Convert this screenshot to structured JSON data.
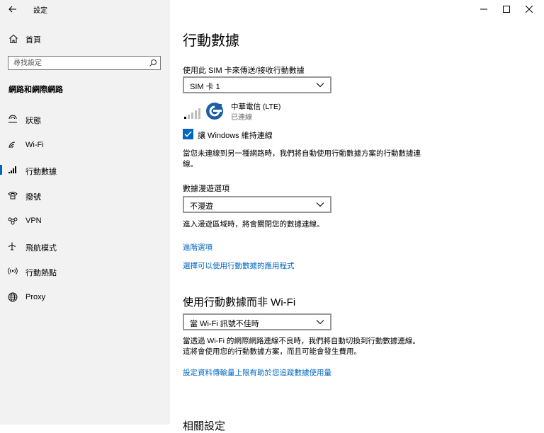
{
  "window": {
    "app_title": "設定",
    "minimize_icon": "minimize-icon",
    "maximize_icon": "maximize-icon",
    "close_icon": "close-icon"
  },
  "sidebar": {
    "home_label": "首頁",
    "search_placeholder": "尋找設定",
    "section_title": "網路和網際網路",
    "items": [
      {
        "label": "狀態",
        "icon": "status-icon"
      },
      {
        "label": "Wi-Fi",
        "icon": "wifi-icon"
      },
      {
        "label": "行動數據",
        "icon": "cellular-icon",
        "selected": true
      },
      {
        "label": "撥號",
        "icon": "dialup-icon"
      },
      {
        "label": "VPN",
        "icon": "vpn-icon"
      },
      {
        "label": "飛航模式",
        "icon": "airplane-icon"
      },
      {
        "label": "行動熱點",
        "icon": "hotspot-icon"
      },
      {
        "label": "Proxy",
        "icon": "globe-icon"
      }
    ],
    "accent_color": "#0067c0"
  },
  "main": {
    "title": "行動數據",
    "sim_label": "使用此 SIM 卡來傳送/接收行動數據",
    "sim_value": "SIM 卡 1",
    "carrier_name": "中華電信 (LTE)",
    "carrier_status": "已連線",
    "keep_connected_label": "讓 Windows 維持連線",
    "keep_connected_checked": true,
    "keep_connected_desc": "當您未連線到另一種網路時，我們將自動使用行動數據方案的行動數據連線。",
    "roaming_label": "數據漫遊選項",
    "roaming_value": "不漫遊",
    "roaming_desc": "進入漫遊區域時，將會關閉您的數據連線。",
    "advanced_link": "進階選項",
    "apps_link": "選擇可以使用行動數據的應用程式",
    "wifi_heading": "使用行動數據而非 Wi-Fi",
    "wifi_value": "當 Wi-Fi 訊號不佳時",
    "wifi_desc": "當透過 Wi-Fi 的網際網路連線不良時，我們將自動切換到行動數據連線。這將會使用您的行動數據方案，而且可能會發生費用。",
    "limit_link": "設定資料傳輸量上限有助於您追蹤數據使用量",
    "related_heading": "相關設定"
  }
}
